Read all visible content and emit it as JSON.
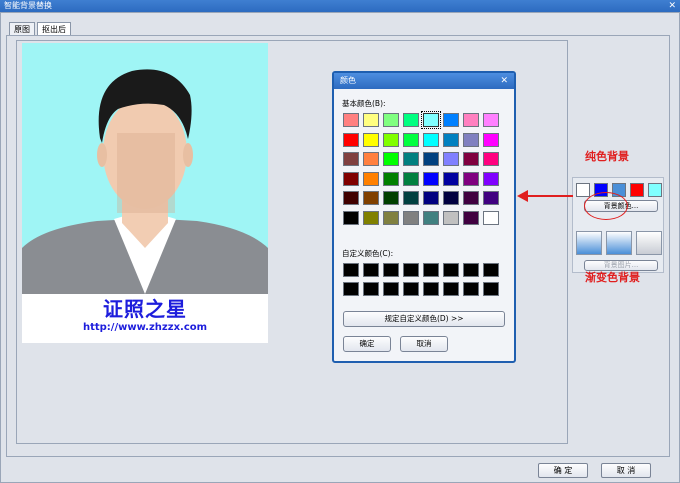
{
  "window": {
    "title": "智能背景替换",
    "close_glyph": "✕"
  },
  "tabs": [
    {
      "label": "原图"
    },
    {
      "label": "抠出后"
    }
  ],
  "photo": {
    "brand_name": "证照之星",
    "brand_url": "http://www.zhzzx.com",
    "background_color": "#9ff5f5"
  },
  "color_dialog": {
    "title": "颜色",
    "close_glyph": "✕",
    "basic_label": "基本颜色(B):",
    "basic_colors": [
      "#ff8080",
      "#ffff80",
      "#80ff80",
      "#00ff80",
      "#80ffff",
      "#0080ff",
      "#ff80c0",
      "#ff80ff",
      "#ff0000",
      "#ffff00",
      "#80ff00",
      "#00ff40",
      "#00ffff",
      "#0080c0",
      "#8080c0",
      "#ff00ff",
      "#804040",
      "#ff8040",
      "#00ff00",
      "#008080",
      "#004080",
      "#8080ff",
      "#800040",
      "#ff0080",
      "#800000",
      "#ff8000",
      "#008000",
      "#008040",
      "#0000ff",
      "#0000a0",
      "#800080",
      "#8000ff",
      "#400000",
      "#804000",
      "#004000",
      "#004040",
      "#000080",
      "#000040",
      "#400040",
      "#400080",
      "#000000",
      "#808000",
      "#808040",
      "#808080",
      "#408080",
      "#c0c0c0",
      "#400040",
      "#ffffff"
    ],
    "selected_index": 4,
    "custom_label": "自定义颜色(C):",
    "define_custom_button": "规定自定义颜色(D) >>",
    "ok_button": "确定",
    "cancel_button": "取消"
  },
  "background_panel": {
    "solid_swatches": [
      "#ffffff",
      "#0000ff",
      "#4a8fd8",
      "#ff0000",
      "#80ffff"
    ],
    "color_button": "背景颜色...",
    "gradient_swatches": [
      "#4a8fd8",
      "#4a8fd8",
      "#c8ccd4"
    ],
    "image_button": "背景图片..."
  },
  "annotations": {
    "solid_label": "纯色背景",
    "gradient_label": "渐变色背景",
    "color": "#e01f1f"
  },
  "footer": {
    "ok_button": "确 定",
    "cancel_button": "取 消"
  }
}
